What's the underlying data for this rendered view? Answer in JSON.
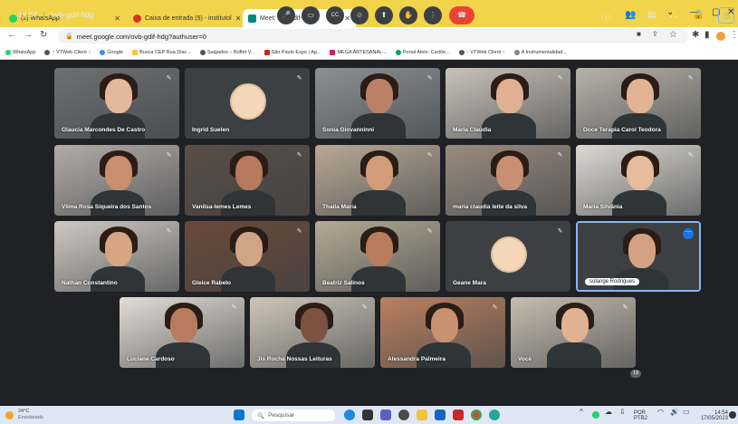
{
  "browser": {
    "tabs": [
      {
        "label": "(2) WhatsApp",
        "color": "#25d366",
        "active": false
      },
      {
        "label": "Caixa de entrada (9) - institutol",
        "color": "#d93025",
        "active": false
      },
      {
        "label": "Meet: ovb-gdif-hdg",
        "color": "#00897b",
        "active": true
      }
    ],
    "new_tab": "+",
    "url": "meet.google.com/ovb-gdif-hdg?authuser=0",
    "bookmarks": [
      "WhatsApp",
      ":: VTWeb Client ::",
      "Google",
      "Busca CEP Rua Diac...",
      "Salgados – Buffet V...",
      "São Paulo Expo | Ag...",
      "MEGA ARTESANAL...",
      "Portal Alelo: Cartõe...",
      ":: VTWeb Client ::",
      "A Instrumentalidad..."
    ]
  },
  "participants": [
    {
      "name": "Glaucia Marcondes De Castro",
      "bg": "#6f7072",
      "skin": "#e5b89c"
    },
    {
      "name": "Ingrid Suelen",
      "bg": "#3c4043",
      "avatar": true
    },
    {
      "name": "Sonia Giovanninni",
      "bg": "#8d8f93",
      "skin": "#b98268"
    },
    {
      "name": "Maria Claudia",
      "bg": "#c9c2b8",
      "skin": "#e0b090"
    },
    {
      "name": "Doce Terapia Carol Teodora",
      "bg": "#b8b2a8",
      "skin": "#e2b494"
    },
    {
      "name": "Vilma Rosa Siqueira dos Santos",
      "bg": "#b3aca8",
      "skin": "#c88f6e"
    },
    {
      "name": "Vanilsa-lemes Lemes",
      "bg": "#5a4e46",
      "skin": "#b67a5c"
    },
    {
      "name": "Thaila Maria",
      "bg": "#b8a896",
      "skin": "#d29c78"
    },
    {
      "name": "maria claudia leite da silva",
      "bg": "#9a8c80",
      "skin": "#c98f72"
    },
    {
      "name": "Maria Silvânia",
      "bg": "#ddd9d2",
      "skin": "#e7bb9b"
    },
    {
      "name": "Nathan Constantino",
      "bg": "#cfc9c2",
      "skin": "#d6a582"
    },
    {
      "name": "Gleice Rabelo",
      "bg": "#6a4a3a",
      "skin": "#d2a486"
    },
    {
      "name": "Beatriz Salinos",
      "bg": "#b5a995",
      "skin": "#b87c5c"
    },
    {
      "name": "Geane Mara",
      "bg": "#3c4043",
      "avatar": true
    },
    {
      "name": "solange Rodrigues",
      "bg": "#3c4043",
      "skin": "#d4a282",
      "pinned": true
    },
    {
      "name": "Luciane Cardoso",
      "bg": "#e3ddd5",
      "skin": "#b77c5e"
    },
    {
      "name": "Jis Rocha Nossas Leituras",
      "bg": "#cfc6b8",
      "skin": "#7c5240"
    },
    {
      "name": "Alessandra Palmeira",
      "bg": "#b98060",
      "skin": "#c9916f"
    },
    {
      "name": "Você",
      "bg": "#c7bcaf",
      "skin": "#e0b292"
    }
  ],
  "meeting": {
    "time": "14:54",
    "separator": "|",
    "code": "ovb-gdif-hdg",
    "participant_count": "19",
    "controls": [
      "mic-icon",
      "camera-icon",
      "captions-icon",
      "emoji-icon",
      "present-icon",
      "raise-hand-icon",
      "more-icon",
      "end-call-icon"
    ]
  },
  "taskbar": {
    "temperature": "24°C",
    "weather": "Ensolarado",
    "search": "Pesquisar",
    "lang_top": "POR",
    "lang_bottom": "PTB2",
    "clock_time": "14:54",
    "clock_date": "17/05/2023"
  }
}
